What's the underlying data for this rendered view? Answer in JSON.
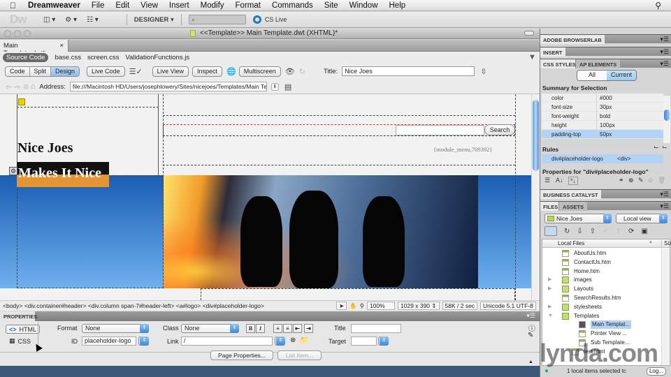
{
  "menubar": {
    "app_name": "Dreamweaver",
    "items": [
      "File",
      "Edit",
      "View",
      "Insert",
      "Modify",
      "Format",
      "Commands",
      "Site",
      "Window",
      "Help"
    ]
  },
  "app_toolbar": {
    "logo": "Dw",
    "workspace": "DESIGNER ▾",
    "search_placeholder": "⌕",
    "cs_live": "CS Live"
  },
  "document": {
    "window_title": "<<Template>> Main Template.dwt (XHTML)*",
    "tab_label": "Main Template.dwt*",
    "tab_close": "×",
    "related_files": [
      "Source Code",
      "base.css",
      "screen.css",
      "ValidationFunctions.js"
    ],
    "view_buttons": [
      "Code",
      "Split",
      "Design"
    ],
    "active_view": "Design",
    "live_code": "Live Code",
    "live_view": "Live View",
    "inspect": "Inspect",
    "multiscreen": "Multiscreen",
    "title_label": "Title:",
    "title_value": "Nice Joes",
    "address_label": "Address:",
    "address_value": "file:///Macintosh HD/Users/josephlowery/Sites/nicejoes/Templates/Main Te"
  },
  "design_view": {
    "site_name": "Nice Joes",
    "tagline": "Makes It Nice",
    "search_button": "Search",
    "module_tag": "{module_menu,709392}"
  },
  "status_bar": {
    "tag_selector": "<body> <div.container#header> <div.column span-7#header-left> <a#logo> <div#placeholder-logo>",
    "zoom": "100%",
    "window_size": "1029 x 390 ⇕",
    "download": "58K / 2 sec",
    "encoding": "Unicode 5.1 UTF-8"
  },
  "properties": {
    "panel_title": "PROPERTIES",
    "mode_html": "HTML",
    "mode_css": "CSS",
    "format_label": "Format",
    "format_value": "None",
    "class_label": "Class",
    "class_value": "None",
    "id_label": "ID",
    "id_value": "placeholder-logo",
    "link_label": "Link",
    "link_value": "/",
    "title_label": "Title",
    "title_value": "",
    "target_label": "Target",
    "target_value": "",
    "page_properties": "Page Properties...",
    "list_item": "List Item..."
  },
  "right_panels": {
    "browserlab": "ADOBE BROWSERLAB",
    "insert": "INSERT",
    "css_styles": "CSS STYLES",
    "ap_elements": "AP ELEMENTS",
    "all": "All",
    "current": "Current",
    "summary_title": "Summary for Selection",
    "summary": [
      {
        "property": "color",
        "value": "#000"
      },
      {
        "property": "font-size",
        "value": "30px"
      },
      {
        "property": "font-weight",
        "value": "bold"
      },
      {
        "property": "height",
        "value": "100px"
      },
      {
        "property": "padding-top",
        "value": "50px"
      }
    ],
    "rules_title": "Rules",
    "rule": {
      "selector": "div#placeholder-logo",
      "tag": "<div>"
    },
    "properties_for": "Properties for \"div#placeholder-logo\"",
    "business_catalyst": "BUSINESS CATALYST",
    "files_tab": "FILES",
    "assets_tab": "ASSETS",
    "site_select": "Nice Joes",
    "view_select": "Local view",
    "col_local": "Local Files",
    "col_size": "Siz",
    "files": [
      {
        "name": "AboutUs.htm",
        "type": "htm",
        "depth": 1,
        "expander": ""
      },
      {
        "name": "ContactUs.htm",
        "type": "htm",
        "depth": 1,
        "expander": ""
      },
      {
        "name": "Home.htm",
        "type": "htm",
        "depth": 1,
        "expander": ""
      },
      {
        "name": "images",
        "type": "folder",
        "depth": 1,
        "expander": "▶"
      },
      {
        "name": "Layouts",
        "type": "folder",
        "depth": 1,
        "expander": "▶"
      },
      {
        "name": "SearchResults.htm",
        "type": "htm",
        "depth": 1,
        "expander": ""
      },
      {
        "name": "stylesheets",
        "type": "folder",
        "depth": 1,
        "expander": "▶"
      },
      {
        "name": "Templates",
        "type": "folder",
        "depth": 1,
        "expander": "▼"
      },
      {
        "name": "Main Templat...",
        "type": "dwt",
        "depth": 2,
        "expander": "",
        "selected": true
      },
      {
        "name": "Printer View ...",
        "type": "htm",
        "depth": 2,
        "expander": ""
      },
      {
        "name": "Sub Template...",
        "type": "htm",
        "depth": 2,
        "expander": ""
      },
      {
        "name": "test.html",
        "type": "htm",
        "depth": 0,
        "expander": ""
      }
    ],
    "files_status": "1 local items selected tc",
    "log_button": "Log..."
  },
  "watermark": "lynda.com"
}
